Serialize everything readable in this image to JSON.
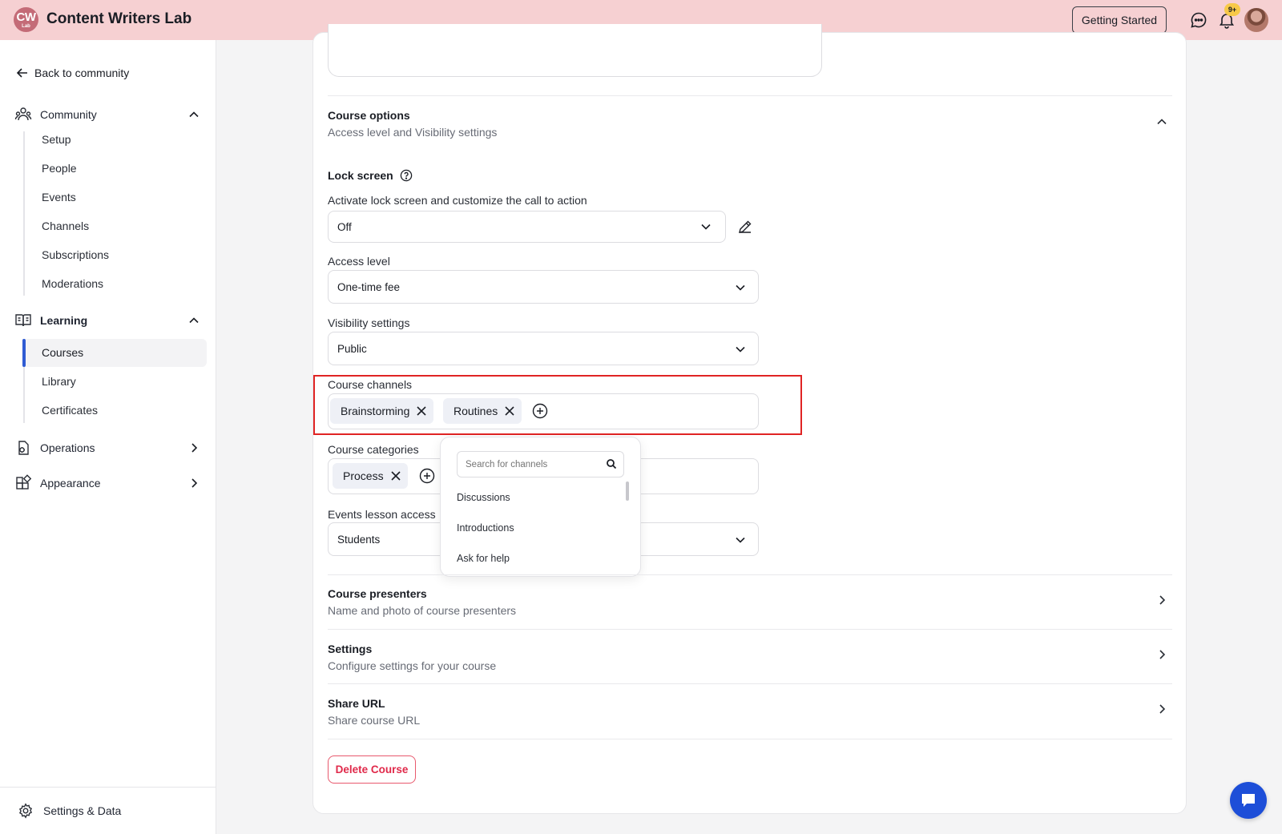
{
  "header": {
    "logo_text": "CW",
    "logo_subtext": "Lab",
    "app_title": "Content Writers Lab",
    "getting_started_label": "Getting Started",
    "notification_badge": "9+"
  },
  "sidebar": {
    "back_label": "Back to community",
    "community": {
      "label": "Community",
      "items": [
        "Setup",
        "People",
        "Events",
        "Channels",
        "Subscriptions",
        "Moderations"
      ]
    },
    "learning": {
      "label": "Learning",
      "items": [
        "Courses",
        "Library",
        "Certificates"
      ],
      "active": "Courses"
    },
    "operations_label": "Operations",
    "appearance_label": "Appearance",
    "settings_label": "Settings & Data"
  },
  "main": {
    "course_options": {
      "title": "Course options",
      "subtitle": "Access level and Visibility settings"
    },
    "lock_screen": {
      "title": "Lock screen",
      "label": "Activate lock screen and customize the call to action",
      "value": "Off"
    },
    "access_level": {
      "label": "Access level",
      "value": "One-time fee"
    },
    "visibility": {
      "label": "Visibility settings",
      "value": "Public"
    },
    "course_channels": {
      "label": "Course channels",
      "chips": [
        "Brainstorming",
        "Routines"
      ]
    },
    "course_categories": {
      "label": "Course categories",
      "chips": [
        "Process"
      ]
    },
    "events_lesson_access": {
      "label": "Events lesson access",
      "value": "Students"
    },
    "channel_dropdown": {
      "placeholder": "Search for channels",
      "items": [
        "Discussions",
        "Introductions",
        "Ask for help"
      ]
    },
    "course_presenters": {
      "title": "Course presenters",
      "subtitle": "Name and photo of course presenters"
    },
    "settings": {
      "title": "Settings",
      "subtitle": "Configure settings for your course"
    },
    "share_url": {
      "title": "Share URL",
      "subtitle": "Share course URL"
    },
    "delete_label": "Delete Course"
  },
  "colors": {
    "topbar": "#f6d0d2",
    "accent": "#2f5bd3",
    "highlight": "#e02424",
    "danger": "#e0294a",
    "chat_button": "#1d4ed8"
  }
}
